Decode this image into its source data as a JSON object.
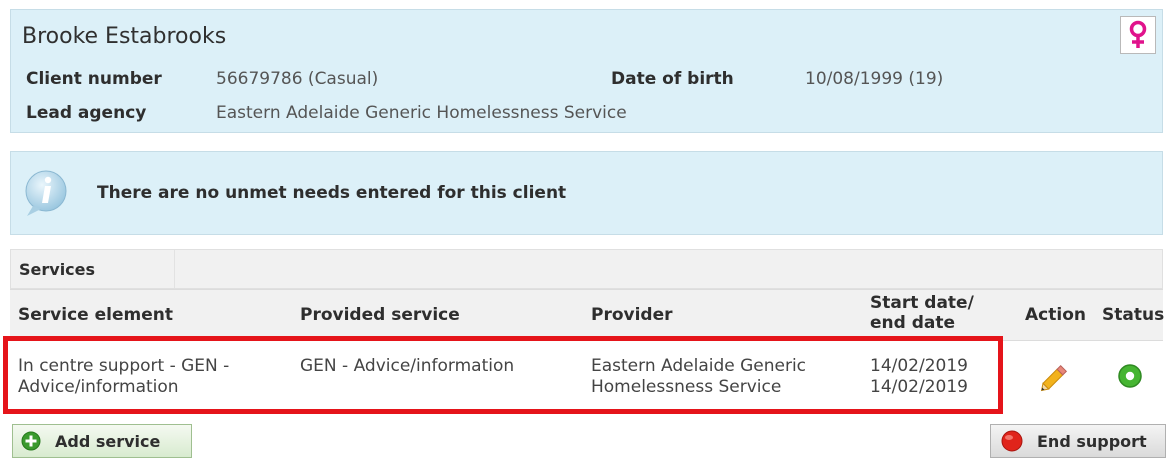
{
  "client": {
    "name": "Brooke Estabrooks",
    "client_number_label": "Client number",
    "client_number_value": "56679786 (Casual)",
    "dob_label": "Date of birth",
    "dob_value": "10/08/1999 (19)",
    "lead_agency_label": "Lead agency",
    "lead_agency_value": "Eastern Adelaide Generic Homelessness Service",
    "gender_icon": "female-icon",
    "gender_color": "#e0138c"
  },
  "info": {
    "icon": "info-icon",
    "message": "There are no unmet needs entered for this client"
  },
  "services": {
    "title": "Services",
    "columns": {
      "element": "Service element",
      "provided": "Provided service",
      "provider": "Provider",
      "dates_line1": "Start date/",
      "dates_line2": "end date",
      "action": "Action",
      "status": "Status"
    },
    "rows": [
      {
        "element_line1": "In centre support - GEN -",
        "element_line2": "Advice/information",
        "provided": "GEN - Advice/information",
        "provider_line1": "Eastern Adelaide Generic",
        "provider_line2": "Homelessness Service",
        "start_date": "14/02/2019",
        "end_date": "14/02/2019",
        "action_icon": "pencil-icon",
        "status_icon": "status-open-icon"
      }
    ]
  },
  "buttons": {
    "add_service": "Add service",
    "end_support": "End support"
  },
  "colors": {
    "panel_bg": "#dcf0f8",
    "highlight_border": "#e5141a",
    "add_icon_green": "#3a9a2e",
    "end_icon_red": "#e0241b",
    "status_green": "#46b532"
  }
}
